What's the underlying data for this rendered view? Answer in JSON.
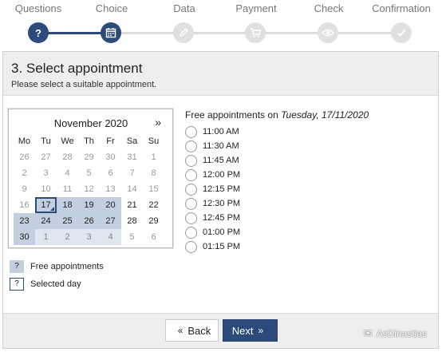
{
  "stepper": {
    "steps": [
      {
        "label": "Questions",
        "state": "done",
        "icon": "question-icon",
        "glyph": "?"
      },
      {
        "label": "Choice",
        "state": "current",
        "icon": "calendar-icon"
      },
      {
        "label": "Data",
        "state": "todo",
        "icon": "pencil-icon"
      },
      {
        "label": "Payment",
        "state": "todo",
        "icon": "cart-icon"
      },
      {
        "label": "Check",
        "state": "todo",
        "icon": "eye-icon"
      },
      {
        "label": "Confirmation",
        "state": "todo",
        "icon": "check-icon"
      }
    ]
  },
  "panel": {
    "title": "3. Select appointment",
    "subtitle": "Please select a suitable appointment."
  },
  "calendar": {
    "month_label": "November 2020",
    "next_label": "»",
    "weekdays": [
      "Mo",
      "Tu",
      "We",
      "Th",
      "Fr",
      "Sa",
      "Su"
    ],
    "rows": [
      [
        {
          "d": "26",
          "s": "other"
        },
        {
          "d": "27",
          "s": "other"
        },
        {
          "d": "28",
          "s": "other"
        },
        {
          "d": "29",
          "s": "other"
        },
        {
          "d": "30",
          "s": "other"
        },
        {
          "d": "31",
          "s": "other"
        },
        {
          "d": "1",
          "s": "other"
        }
      ],
      [
        {
          "d": "2",
          "s": "other"
        },
        {
          "d": "3",
          "s": "other"
        },
        {
          "d": "4",
          "s": "other"
        },
        {
          "d": "5",
          "s": "other"
        },
        {
          "d": "6",
          "s": "other"
        },
        {
          "d": "7",
          "s": "other"
        },
        {
          "d": "8",
          "s": "other"
        }
      ],
      [
        {
          "d": "9",
          "s": "other"
        },
        {
          "d": "10",
          "s": "other"
        },
        {
          "d": "11",
          "s": "other"
        },
        {
          "d": "12",
          "s": "other"
        },
        {
          "d": "13",
          "s": "other"
        },
        {
          "d": "14",
          "s": "other"
        },
        {
          "d": "15",
          "s": "other"
        }
      ],
      [
        {
          "d": "16",
          "s": "other"
        },
        {
          "d": "17",
          "s": "selected"
        },
        {
          "d": "18",
          "s": "free"
        },
        {
          "d": "19",
          "s": "free"
        },
        {
          "d": "20",
          "s": "free"
        },
        {
          "d": "21",
          "s": "cur"
        },
        {
          "d": "22",
          "s": "cur"
        }
      ],
      [
        {
          "d": "23",
          "s": "free"
        },
        {
          "d": "24",
          "s": "free"
        },
        {
          "d": "25",
          "s": "free"
        },
        {
          "d": "26",
          "s": "free"
        },
        {
          "d": "27",
          "s": "free"
        },
        {
          "d": "28",
          "s": "cur"
        },
        {
          "d": "29",
          "s": "cur"
        }
      ],
      [
        {
          "d": "30",
          "s": "free"
        },
        {
          "d": "1",
          "s": "free-other"
        },
        {
          "d": "2",
          "s": "free-other"
        },
        {
          "d": "3",
          "s": "free-other"
        },
        {
          "d": "4",
          "s": "free-other"
        },
        {
          "d": "5",
          "s": "other"
        },
        {
          "d": "6",
          "s": "other"
        }
      ]
    ]
  },
  "legend": {
    "free_symbol": "?",
    "free_label": "Free appointments",
    "selected_symbol": "?",
    "selected_label": "Selected day"
  },
  "slots": {
    "title_prefix": "Free appointments on",
    "title_date": "Tuesday, 17/11/2020",
    "times": [
      "11:00 AM",
      "11:30 AM",
      "11:45 AM",
      "12:00 PM",
      "12:15 PM",
      "12:30 PM",
      "12:45 PM",
      "01:00 PM",
      "01:15 PM"
    ]
  },
  "footer": {
    "back_label": "Back",
    "back_chevron": "«",
    "next_label": "Next",
    "next_chevron": "»"
  },
  "watermark": {
    "text": "AsDinastias"
  },
  "colors": {
    "accent": "#2c4a7a",
    "free_day": "#c2cfe0",
    "inactive_step": "#e0e0e0"
  }
}
